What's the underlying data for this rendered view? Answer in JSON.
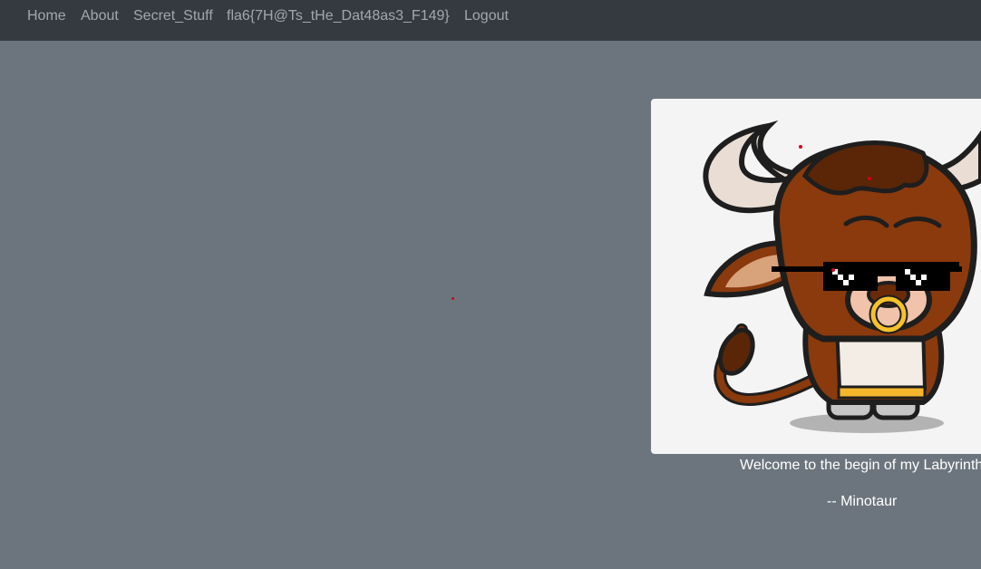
{
  "nav": {
    "home": "Home",
    "about": "About",
    "secret": "Secret_Stuff",
    "flag": "fla6{7H@Ts_tHe_Dat48as3_F149}",
    "logout": "Logout"
  },
  "main": {
    "image_alt": "minotaur-mascot",
    "welcome": "Welcome to the begin of my Labyrinth",
    "signature": "-- Minotaur"
  },
  "colors": {
    "navbar": "#343a40",
    "background": "#6c757d",
    "nav_link": "rgba(255,255,255,0.55)"
  }
}
